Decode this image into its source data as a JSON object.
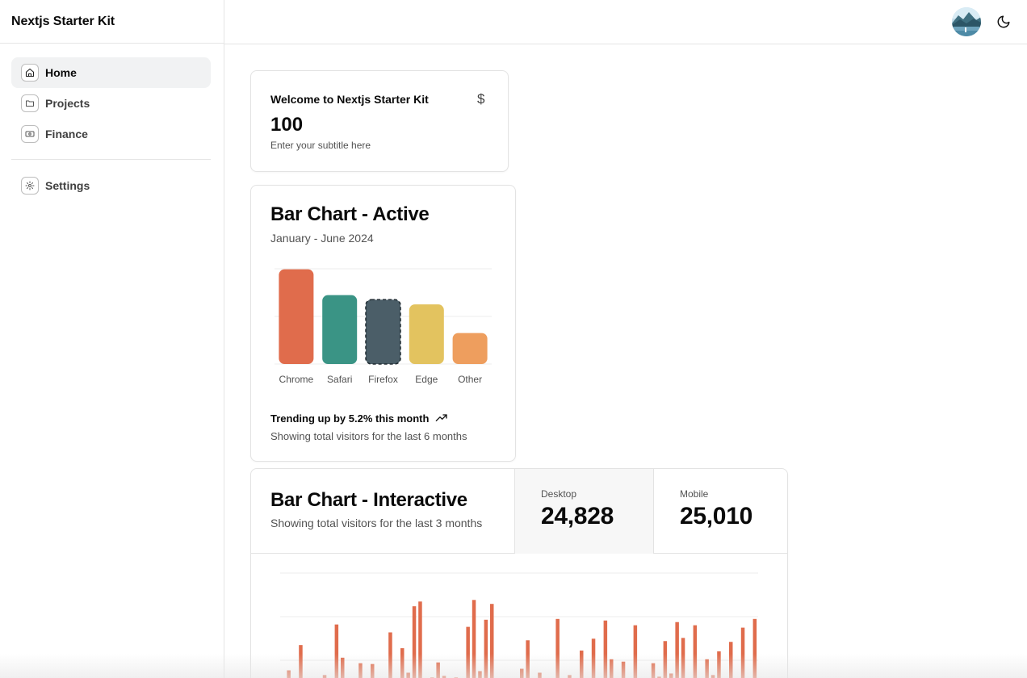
{
  "app": {
    "brand": "Nextjs Starter Kit"
  },
  "sidebar": {
    "items": [
      {
        "label": "Home",
        "icon": "home-icon",
        "active": true
      },
      {
        "label": "Projects",
        "icon": "folder-icon",
        "active": false
      },
      {
        "label": "Finance",
        "icon": "banknote-icon",
        "active": false
      }
    ],
    "footer_items": [
      {
        "label": "Settings",
        "icon": "gear-icon"
      }
    ]
  },
  "header": {
    "avatar": "user-avatar",
    "theme_icon": "moon-icon"
  },
  "welcome_card": {
    "title": "Welcome to Nextjs Starter Kit",
    "icon": "dollar-icon",
    "value": "100",
    "subtitle": "Enter your subtitle here"
  },
  "bar_card": {
    "title": "Bar Chart - Active",
    "description": "January - June 2024",
    "trend": "Trending up by 5.2% this month",
    "trend_icon": "trending-up-icon",
    "footer": "Showing total visitors for the last 6 months"
  },
  "interactive_card": {
    "title": "Bar Chart - Interactive",
    "description": "Showing total visitors for the last 3 months",
    "desktop_label": "Desktop",
    "desktop_value": "24,828",
    "mobile_label": "Mobile",
    "mobile_value": "25,010"
  },
  "colors": {
    "chrome": "#e06c4c",
    "safari": "#3a9485",
    "firefox": "#4b5e68",
    "edge": "#e3c35f",
    "other": "#ee9e5e",
    "interactive_bar": "#e06c4c"
  },
  "chart_data": [
    {
      "type": "bar",
      "categories": [
        "Chrome",
        "Safari",
        "Firefox",
        "Edge",
        "Other"
      ],
      "values": [
        275,
        200,
        187,
        173,
        90
      ],
      "active_index": 2,
      "title": "Bar Chart - Active",
      "subtitle": "January - June 2024",
      "grid": true
    },
    {
      "type": "bar",
      "series": [
        {
          "values": [
            5,
            26,
            3,
            58,
            6,
            4,
            16,
            20,
            6,
            84,
            42,
            6,
            2,
            35,
            2,
            34,
            1,
            16,
            74,
            1,
            54,
            23,
            107,
            113,
            0,
            17,
            36,
            19,
            1,
            17,
            10,
            81,
            115,
            25,
            90,
            110,
            13,
            0,
            1,
            11,
            28,
            64,
            0,
            23,
            1,
            12,
            91,
            0,
            20,
            2,
            51,
            0,
            66,
            0,
            89,
            40,
            1,
            37,
            15,
            83,
            4,
            16,
            35,
            18,
            63,
            22,
            87,
            67,
            11,
            83,
            0,
            40,
            20,
            50,
            0,
            62,
            14,
            80,
            0,
            91
          ]
        }
      ],
      "title": "Bar Chart - Interactive",
      "grid": true
    }
  ]
}
